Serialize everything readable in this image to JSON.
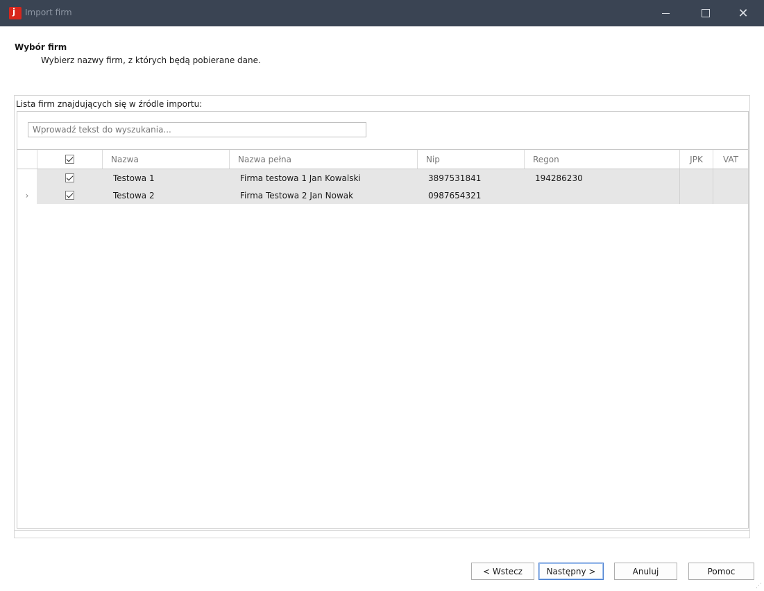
{
  "window": {
    "title": "Import firm",
    "controls": {
      "minimize": "–",
      "maximize": "□",
      "close": "✕"
    }
  },
  "header": {
    "title": "Wybór firm",
    "subtitle": "Wybierz nazwy firm, z których będą pobierane dane."
  },
  "list": {
    "label": "Lista firm znajdujących się w źródle importu:",
    "search_placeholder": "Wprowadź tekst do wyszukania...",
    "header_checked": true,
    "columns": [
      "Nazwa",
      "Nazwa pełna",
      "Nip",
      "Regon",
      "JPK",
      "VAT"
    ],
    "rows": [
      {
        "indicator": "",
        "checked": true,
        "nazwa": "Testowa 1",
        "nazwa_pelna": "Firma testowa 1 Jan Kowalski",
        "nip": "3897531841",
        "regon": "194286230",
        "jpk": "",
        "vat": ""
      },
      {
        "indicator": "›",
        "checked": true,
        "nazwa": "Testowa 2",
        "nazwa_pelna": "Firma Testowa 2 Jan Nowak",
        "nip": "0987654321",
        "regon": "",
        "jpk": "",
        "vat": ""
      }
    ]
  },
  "buttons": {
    "back": "< Wstecz",
    "next": "Następny >",
    "cancel": "Anuluj",
    "help": "Pomoc"
  }
}
